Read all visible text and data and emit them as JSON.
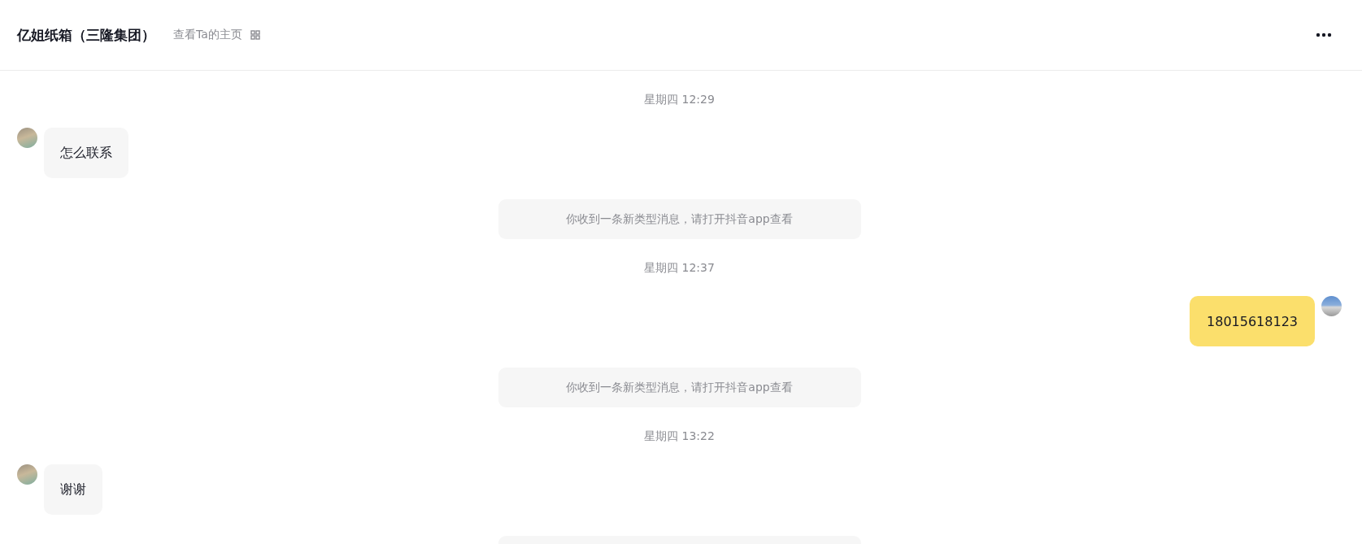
{
  "header": {
    "title": "亿姐纸箱（三隆集团）",
    "profile_link": "查看Ta的主页"
  },
  "messages": [
    {
      "kind": "time",
      "text": "星期四 12:29"
    },
    {
      "kind": "incoming",
      "text": "怎么联系"
    },
    {
      "kind": "notice",
      "text": "你收到一条新类型消息，请打开抖音app查看"
    },
    {
      "kind": "time",
      "text": "星期四 12:37"
    },
    {
      "kind": "outgoing",
      "text": "18015618123"
    },
    {
      "kind": "notice",
      "text": "你收到一条新类型消息，请打开抖音app查看"
    },
    {
      "kind": "time",
      "text": "星期四 13:22"
    },
    {
      "kind": "incoming",
      "text": "谢谢"
    },
    {
      "kind": "notice"
    }
  ]
}
